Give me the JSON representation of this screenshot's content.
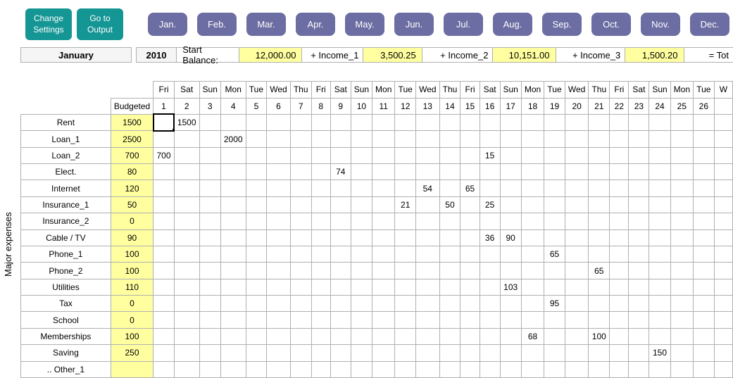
{
  "buttons": {
    "change_settings": "Change\nSettings",
    "goto_output": "Go to\nOutput"
  },
  "months": [
    "Jan.",
    "Feb.",
    "Mar.",
    "Apr.",
    "May.",
    "Jun.",
    "Jul.",
    "Aug.",
    "Sep.",
    "Oct.",
    "Nov.",
    "Dec."
  ],
  "header": {
    "current_month": "January",
    "year": "2010",
    "start_balance_label": "Start Balance:",
    "start_balance": "12,000.00",
    "income1_label": "+ Income_1",
    "income1": "3,500.25",
    "income2_label": "+ Income_2",
    "income2": "10,151.00",
    "income3_label": "+ Income_3",
    "income3": "1,500.20",
    "total_label": "= Tot"
  },
  "section_label": "Major expenses",
  "budgeted_label": "Budgeted",
  "weekdays": [
    "Fri",
    "Sat",
    "Sun",
    "Mon",
    "Tue",
    "Wed",
    "Thu",
    "Fri",
    "Sat",
    "Sun",
    "Mon",
    "Tue",
    "Wed",
    "Thu",
    "Fri",
    "Sat",
    "Sun",
    "Mon",
    "Tue",
    "Wed",
    "Thu",
    "Fri",
    "Sat",
    "Sun",
    "Mon",
    "Tue",
    "W"
  ],
  "daynums": [
    "1",
    "2",
    "3",
    "4",
    "5",
    "6",
    "7",
    "8",
    "9",
    "10",
    "11",
    "12",
    "13",
    "14",
    "15",
    "16",
    "17",
    "18",
    "19",
    "20",
    "21",
    "22",
    "23",
    "24",
    "25",
    "26",
    ""
  ],
  "rows": [
    {
      "label": "Rent",
      "budget": "1500",
      "cells": {
        "2": "1500"
      }
    },
    {
      "label": "Loan_1",
      "budget": "2500",
      "cells": {
        "4": "2000"
      }
    },
    {
      "label": "Loan_2",
      "budget": "700",
      "cells": {
        "1": "700",
        "16": "15"
      }
    },
    {
      "label": "Elect.",
      "budget": "80",
      "cells": {
        "9": "74"
      }
    },
    {
      "label": "Internet",
      "budget": "120",
      "cells": {
        "13": "54",
        "15": "65"
      }
    },
    {
      "label": "Insurance_1",
      "budget": "50",
      "cells": {
        "12": "21",
        "14": "50",
        "16": "25"
      }
    },
    {
      "label": "Insurance_2",
      "budget": "0",
      "cells": {}
    },
    {
      "label": "Cable / TV",
      "budget": "90",
      "cells": {
        "16": "36",
        "17": "90"
      }
    },
    {
      "label": "Phone_1",
      "budget": "100",
      "cells": {
        "19": "65"
      }
    },
    {
      "label": "Phone_2",
      "budget": "100",
      "cells": {
        "21": "65"
      }
    },
    {
      "label": "Utilities",
      "budget": "110",
      "cells": {
        "17": "103"
      }
    },
    {
      "label": "Tax",
      "budget": "0",
      "cells": {
        "19": "95"
      }
    },
    {
      "label": "School",
      "budget": "0",
      "cells": {}
    },
    {
      "label": "Memberships",
      "budget": "100",
      "cells": {
        "18": "68",
        "21": "100"
      }
    },
    {
      "label": "Saving",
      "budget": "250",
      "cells": {
        "24": "150"
      }
    },
    {
      "label": ".. Other_1",
      "budget": "",
      "cells": {}
    }
  ]
}
